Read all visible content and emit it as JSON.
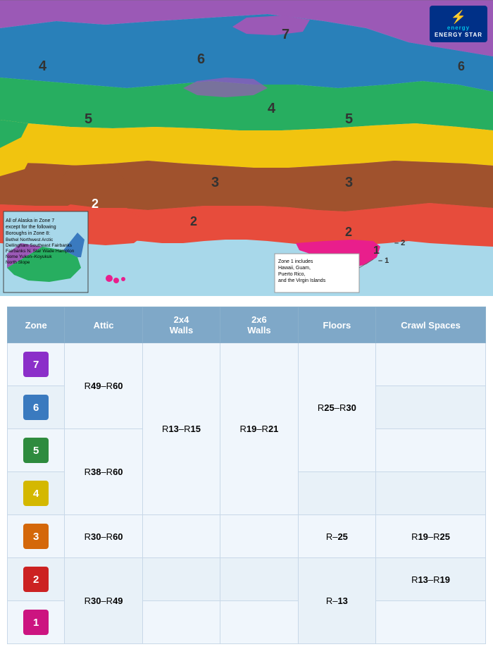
{
  "map": {
    "alaska_note": {
      "title": "All of Alaska in Zone 7",
      "subtitle": "except for the following Boroughs in Zone 8:",
      "left_column": [
        "Bethel",
        "Dellingham",
        "Fairbanks N. Star",
        "Nome",
        "North Slope"
      ],
      "right_column": [
        "Northwest Arctic",
        "Southeast Fairbanks",
        "Wade Hampton",
        "Yukon–Koyukuk"
      ]
    },
    "zone1_note": "Zone 1 includes Hawaii, Guam, Puerto Rico, and the Virgin Islands"
  },
  "energy_star": {
    "label": "ENERGY STAR"
  },
  "table": {
    "headers": [
      "Zone",
      "Attic",
      "2x4 Walls",
      "2x6 Walls",
      "Floors",
      "Crawl Spaces"
    ],
    "rows": [
      {
        "zone": "7",
        "zone_class": "zone-7",
        "attic": "R49–R60",
        "attic_rowspan": 2,
        "walls_2x4": "R13–R15",
        "walls_2x4_rowspan": 4,
        "walls_2x6": "R19–R21",
        "walls_2x6_rowspan": 4,
        "floors": "R25–R30",
        "floors_rowspan": 3,
        "crawl": ""
      },
      {
        "zone": "6",
        "zone_class": "zone-6",
        "attic": null,
        "crawl": ""
      },
      {
        "zone": "5",
        "zone_class": "zone-5",
        "attic": "R38–R60",
        "attic_rowspan": 2,
        "floors": null,
        "crawl": ""
      },
      {
        "zone": "4",
        "zone_class": "zone-4",
        "attic": null,
        "floors": null,
        "crawl": ""
      },
      {
        "zone": "3",
        "zone_class": "zone-3",
        "attic": "R30–R60",
        "walls_2x4": null,
        "walls_2x6": null,
        "floors": "R-25",
        "crawl": "R19–R25"
      },
      {
        "zone": "2",
        "zone_class": "zone-2",
        "attic": "R30–R49",
        "attic_rowspan": 2,
        "walls_2x4": null,
        "walls_2x6": null,
        "floors": "R-13",
        "floors_rowspan": 2,
        "crawl": "R13–R19"
      },
      {
        "zone": "1",
        "zone_class": "zone-1",
        "attic": null,
        "walls_2x4": null,
        "walls_2x6": null,
        "floors": null,
        "crawl": ""
      }
    ]
  }
}
